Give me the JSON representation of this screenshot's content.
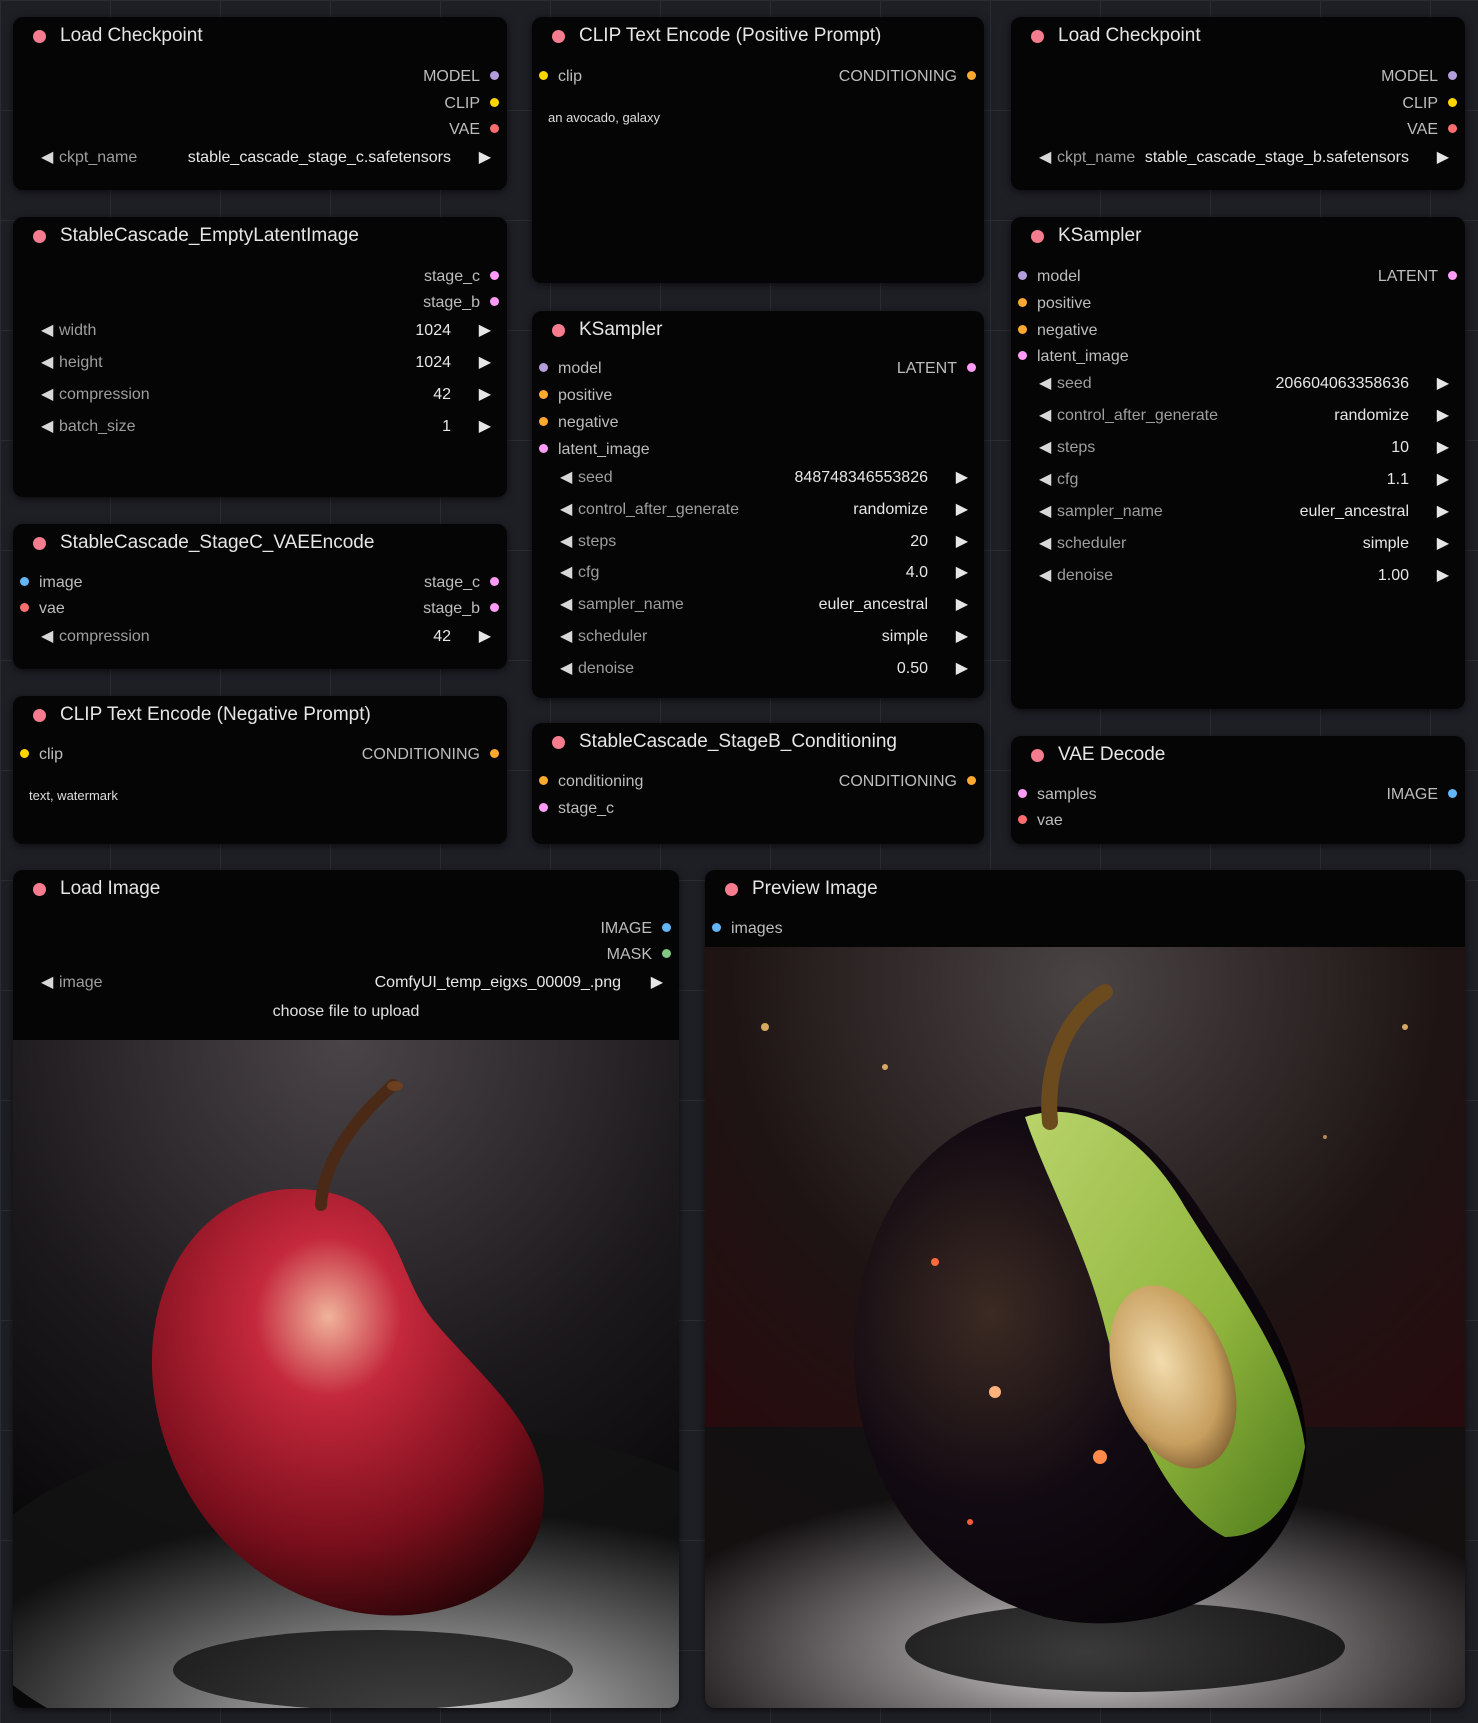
{
  "colors": {
    "title_dot": "#f47c8e",
    "model": "#b39ddb",
    "clip": "#ffd500",
    "vae": "#ff6e6e",
    "latent": "#ff9cf9",
    "conditioning": "#ffa931",
    "image": "#64b5f6",
    "mask": "#81c784"
  },
  "nodes": {
    "ckpt_c": {
      "title": "Load Checkpoint",
      "outputs": [
        "MODEL",
        "CLIP",
        "VAE"
      ],
      "widget_name": "ckpt_name",
      "widget_value": "stable_cascade_stage_c.safetensors"
    },
    "pos_prompt": {
      "title": "CLIP Text Encode (Positive Prompt)",
      "input": "clip",
      "output": "CONDITIONING",
      "text": "an avocado, galaxy"
    },
    "ckpt_b": {
      "title": "Load Checkpoint",
      "outputs": [
        "MODEL",
        "CLIP",
        "VAE"
      ],
      "widget_name": "ckpt_name",
      "widget_value": "stable_cascade_stage_b.safetensors"
    },
    "empty_latent": {
      "title": "StableCascade_EmptyLatentImage",
      "outputs": [
        "stage_c",
        "stage_b"
      ],
      "widgets": [
        {
          "name": "width",
          "value": "1024"
        },
        {
          "name": "height",
          "value": "1024"
        },
        {
          "name": "compression",
          "value": "42"
        },
        {
          "name": "batch_size",
          "value": "1"
        }
      ]
    },
    "ksampler_mid": {
      "title": "KSampler",
      "inputs": [
        "model",
        "positive",
        "negative",
        "latent_image"
      ],
      "output": "LATENT",
      "widgets": [
        {
          "name": "seed",
          "value": "848748346553826"
        },
        {
          "name": "control_after_generate",
          "value": "randomize"
        },
        {
          "name": "steps",
          "value": "20"
        },
        {
          "name": "cfg",
          "value": "4.0"
        },
        {
          "name": "sampler_name",
          "value": "euler_ancestral"
        },
        {
          "name": "scheduler",
          "value": "simple"
        },
        {
          "name": "denoise",
          "value": "0.50"
        }
      ]
    },
    "ksampler_right": {
      "title": "KSampler",
      "inputs": [
        "model",
        "positive",
        "negative",
        "latent_image"
      ],
      "output": "LATENT",
      "widgets": [
        {
          "name": "seed",
          "value": "206604063358636"
        },
        {
          "name": "control_after_generate",
          "value": "randomize"
        },
        {
          "name": "steps",
          "value": "10"
        },
        {
          "name": "cfg",
          "value": "1.1"
        },
        {
          "name": "sampler_name",
          "value": "euler_ancestral"
        },
        {
          "name": "scheduler",
          "value": "simple"
        },
        {
          "name": "denoise",
          "value": "1.00"
        }
      ]
    },
    "vae_encode": {
      "title": "StableCascade_StageC_VAEEncode",
      "inputs": [
        "image",
        "vae"
      ],
      "outputs": [
        "stage_c",
        "stage_b"
      ],
      "widget_name": "compression",
      "widget_value": "42"
    },
    "neg_prompt": {
      "title": "CLIP Text Encode (Negative Prompt)",
      "input": "clip",
      "output": "CONDITIONING",
      "text": "text, watermark"
    },
    "stageb_cond": {
      "title": "StableCascade_StageB_Conditioning",
      "inputs": [
        "conditioning",
        "stage_c"
      ],
      "output": "CONDITIONING"
    },
    "vae_decode": {
      "title": "VAE Decode",
      "inputs": [
        "samples",
        "vae"
      ],
      "output": "IMAGE"
    },
    "load_image": {
      "title": "Load Image",
      "outputs": [
        "IMAGE",
        "MASK"
      ],
      "widget_name": "image",
      "widget_value": "ComfyUI_temp_eigxs_00009_.png",
      "upload_label": "choose file to upload"
    },
    "preview": {
      "title": "Preview Image",
      "input": "images"
    }
  },
  "arrows": {
    "left": "◀",
    "right": "▶"
  }
}
